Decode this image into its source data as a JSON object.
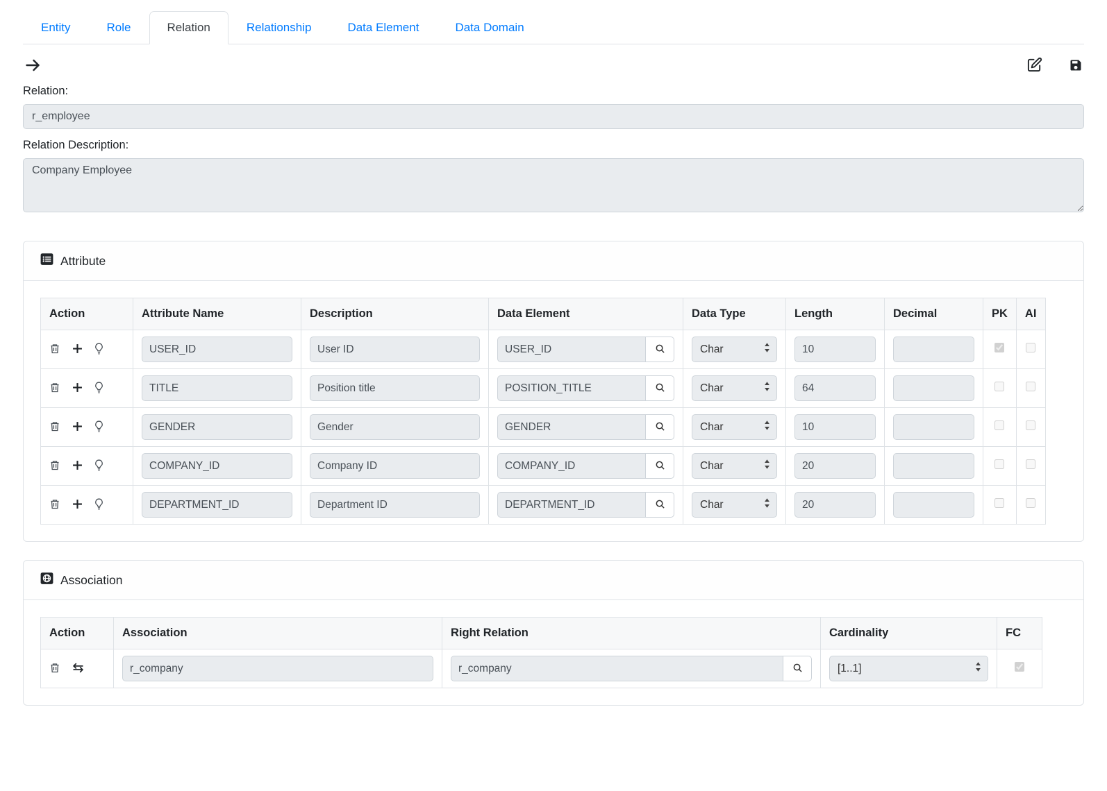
{
  "tabs": [
    {
      "label": "Entity",
      "active": false
    },
    {
      "label": "Role",
      "active": false
    },
    {
      "label": "Relation",
      "active": true
    },
    {
      "label": "Relationship",
      "active": false
    },
    {
      "label": "Data Element",
      "active": false
    },
    {
      "label": "Data Domain",
      "active": false
    }
  ],
  "toolbar": {
    "icons": [
      "arrow-right",
      "edit",
      "save"
    ]
  },
  "form": {
    "relation_label": "Relation:",
    "relation_value": "r_employee",
    "description_label": "Relation Description:",
    "description_value": "Company Employee"
  },
  "attribute_panel": {
    "title": "Attribute",
    "columns": [
      "Action",
      "Attribute Name",
      "Description",
      "Data Element",
      "Data Type",
      "Length",
      "Decimal",
      "PK",
      "AI"
    ],
    "rows": [
      {
        "attribute_name": "USER_ID",
        "description": "User ID",
        "data_element": "USER_ID",
        "data_type": "Char",
        "length": "10",
        "decimal": "",
        "pk": true,
        "ai": false
      },
      {
        "attribute_name": "TITLE",
        "description": "Position title",
        "data_element": "POSITION_TITLE",
        "data_type": "Char",
        "length": "64",
        "decimal": "",
        "pk": false,
        "ai": false
      },
      {
        "attribute_name": "GENDER",
        "description": "Gender",
        "data_element": "GENDER",
        "data_type": "Char",
        "length": "10",
        "decimal": "",
        "pk": false,
        "ai": false
      },
      {
        "attribute_name": "COMPANY_ID",
        "description": "Company ID",
        "data_element": "COMPANY_ID",
        "data_type": "Char",
        "length": "20",
        "decimal": "",
        "pk": false,
        "ai": false
      },
      {
        "attribute_name": "DEPARTMENT_ID",
        "description": "Department ID",
        "data_element": "DEPARTMENT_ID",
        "data_type": "Char",
        "length": "20",
        "decimal": "",
        "pk": false,
        "ai": false
      }
    ]
  },
  "association_panel": {
    "title": "Association",
    "columns": [
      "Action",
      "Association",
      "Right Relation",
      "Cardinality",
      "FC"
    ],
    "rows": [
      {
        "association": "r_company",
        "right_relation": "r_company",
        "cardinality": "[1..1]",
        "fc": true
      }
    ]
  }
}
